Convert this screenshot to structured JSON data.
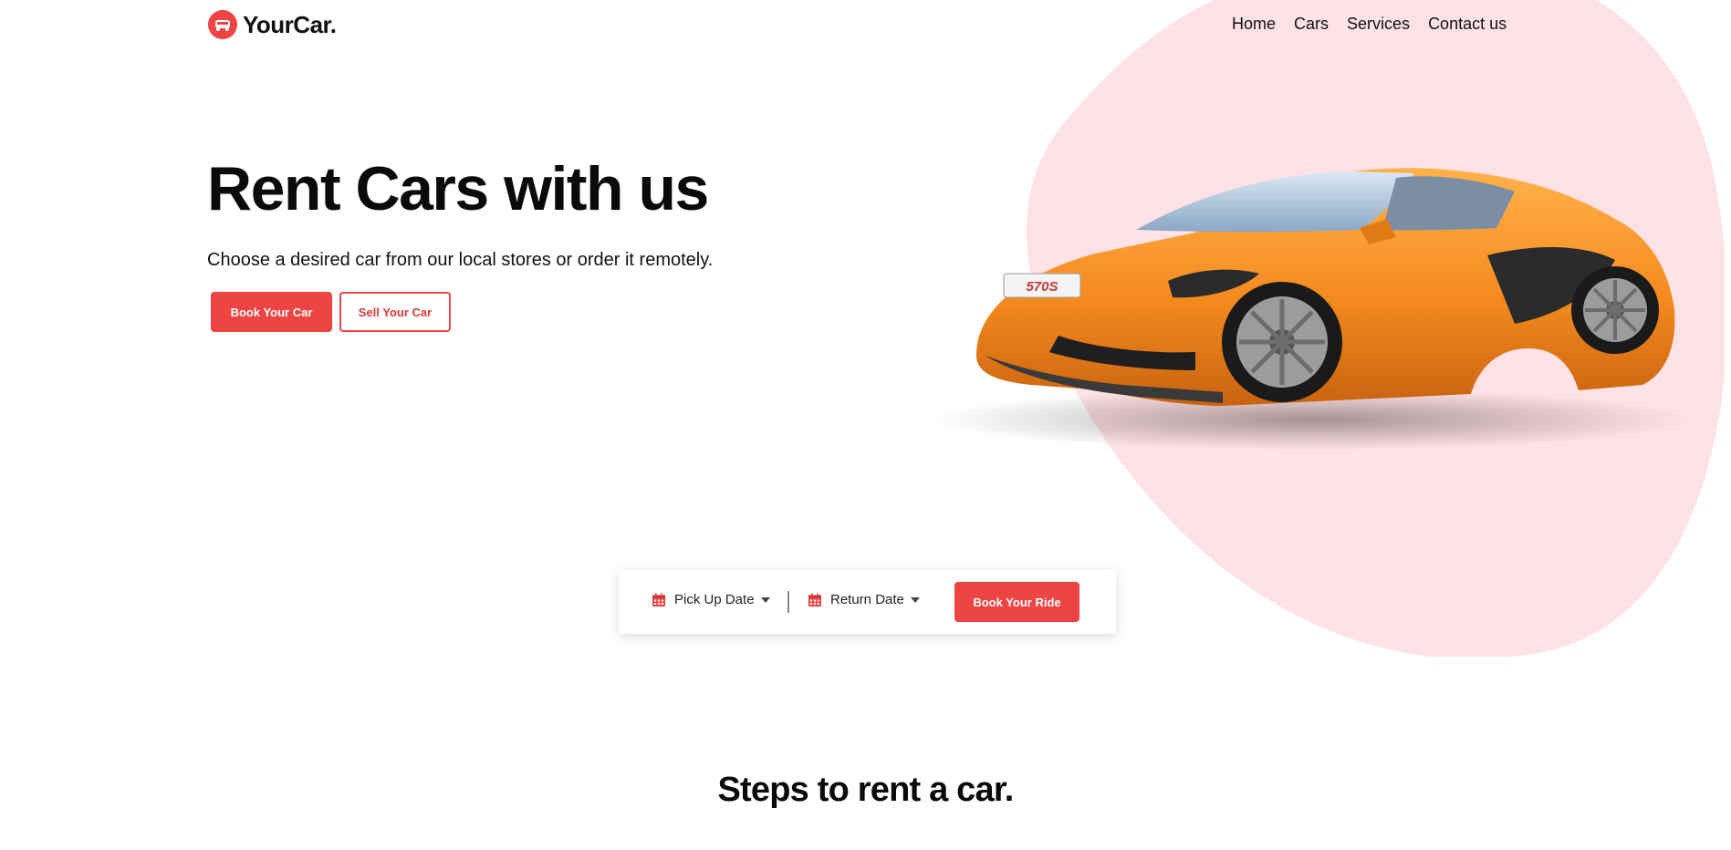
{
  "brand": {
    "name": "YourCar.",
    "accent": "#ee4444",
    "blob_color": "#ffe2e6"
  },
  "nav": {
    "items": [
      {
        "label": "Home"
      },
      {
        "label": "Cars"
      },
      {
        "label": "Services"
      },
      {
        "label": "Contact us"
      }
    ]
  },
  "hero": {
    "title": "Rent Cars with us",
    "subtitle": "Choose a desired car from our local stores or order it remotely.",
    "primary_button": "Book Your Car",
    "secondary_button": "Sell Your Car",
    "car_plate": "570S",
    "car_color": "#f58a1f"
  },
  "booking": {
    "pickup_label": "Pick Up Date",
    "return_label": "Return Date",
    "button_label": "Book Your Ride",
    "icon": "calendar-icon"
  },
  "steps": {
    "title": "Steps to rent a car."
  }
}
